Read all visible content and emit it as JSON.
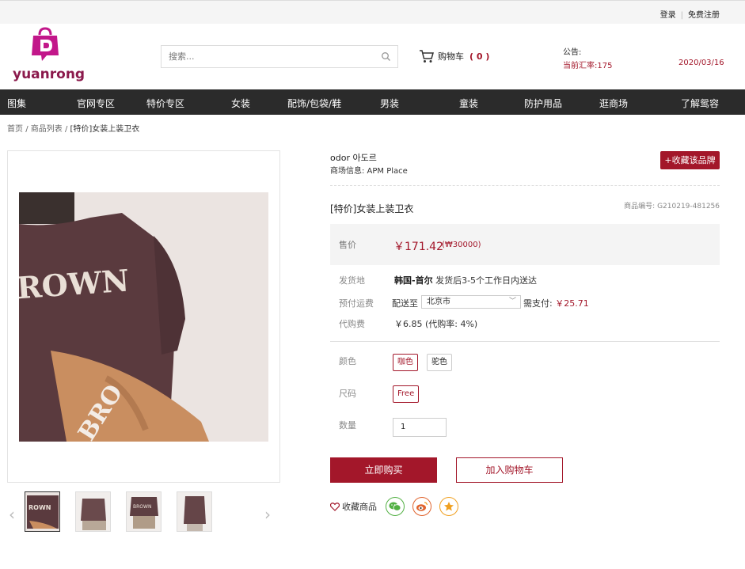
{
  "header": {
    "login": "登录",
    "register": "免费注册",
    "logo_text": "yuanrong",
    "search_placeholder": "搜索...",
    "cart_label": "购物车",
    "cart_count": "( 0 )",
    "notice_label": "公告:",
    "rate_text": "当前汇率:175",
    "date": "2020/03/16"
  },
  "nav": {
    "items": [
      "图集",
      "官网专区",
      "特价专区",
      "女装",
      "配饰/包袋/鞋",
      "男装",
      "童装",
      "防护用品",
      "逛商场",
      "了解鸳容"
    ]
  },
  "breadcrumb": {
    "home": "首页",
    "list": "商品列表",
    "current": "[特价]女装上装卫衣",
    "sep": "/"
  },
  "product": {
    "brand": "odor 아도르",
    "mall": "商场信息:  APM Place",
    "fav_brand": "+收藏该品牌",
    "title": "[特价]女装上装卫衣",
    "code": "商品编号:  G210219-481256",
    "price_label": "售价",
    "price": "￥171.42",
    "orig_price": "(₩30000)",
    "origin_label": "发货地",
    "origin_place": "韩国-首尔",
    "origin_note": " 发货后3-5个工作日内送达",
    "shipping_label": "预付运费",
    "deliver_to": "配送至",
    "city": "北京市",
    "need_pay_label": "需支付:",
    "need_pay_value": "￥25.71",
    "fee_label": "代购费",
    "fee_value": "￥6.85  (代购率:  4%)",
    "color_label": "颜色",
    "colors": [
      "咖色",
      "驼色"
    ],
    "size_label": "尺码",
    "sizes": [
      "Free"
    ],
    "qty_label": "数量",
    "qty_value": "1",
    "buy_now": "立即购买",
    "add_cart": "加入购物车",
    "fav_product": "收藏商品",
    "image_text": "ROWN",
    "sleeve_text": "BRO"
  },
  "colors": {
    "accent": "#a3172a",
    "nav_bg": "#2b2b2b",
    "sweater": "#5a3a3e",
    "wechat": "#52b043",
    "weibo": "#e0632d",
    "qzone": "#f0a020"
  }
}
